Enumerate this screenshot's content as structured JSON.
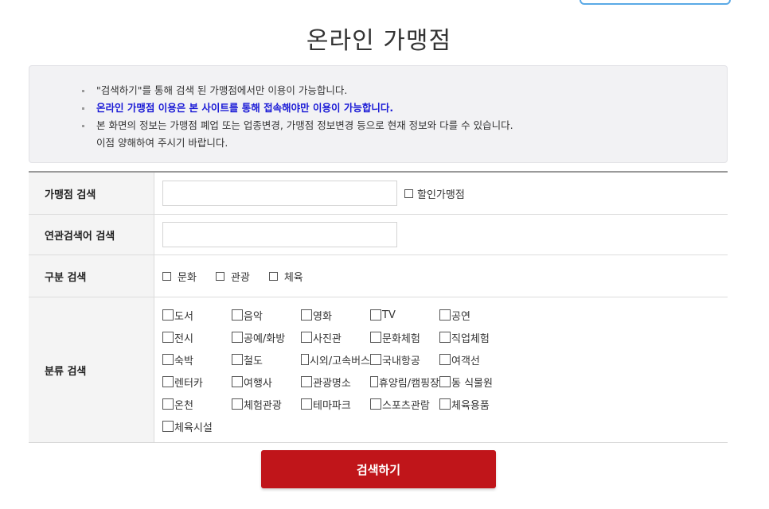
{
  "page_title": "온라인 가맹점",
  "notice": {
    "items": [
      "\"검색하기\"를 통해 검색 된 가맹점에서만 이용이 가능합니다.",
      "온라인 가맹점 이용은 본 사이트를 통해 접속해야만 이용이 가능합니다.",
      "본 화면의 정보는 가맹점 폐업 또는 업종변경, 가맹점 정보변경 등으로 현재 정보와 다를 수 있습니다."
    ],
    "continuation": "이점 양해하여 주시기 바랍니다."
  },
  "rows": {
    "store_search": {
      "label": "가맹점 검색",
      "input_value": "",
      "discount_label": "할인가맹점"
    },
    "keyword_search": {
      "label": "연관검색어 검색",
      "input_value": ""
    },
    "type_search": {
      "label": "구분 검색",
      "options": [
        "문화",
        "관광",
        "체육"
      ]
    },
    "category_search": {
      "label": "분류 검색",
      "options": [
        "도서",
        "음악",
        "영화",
        "TV",
        "공연",
        "전시",
        "공예/화방",
        "사진관",
        "문화체험",
        "직업체험",
        "숙박",
        "철도",
        "시외/고속버스",
        "국내항공",
        "여객선",
        "렌터카",
        "여행사",
        "관광명소",
        "휴양림/캠핑장",
        "동 식물원",
        "온천",
        "체험관광",
        "테마파크",
        "스포츠관람",
        "체육용품",
        "체육시설"
      ]
    }
  },
  "search_button_label": "검색하기"
}
